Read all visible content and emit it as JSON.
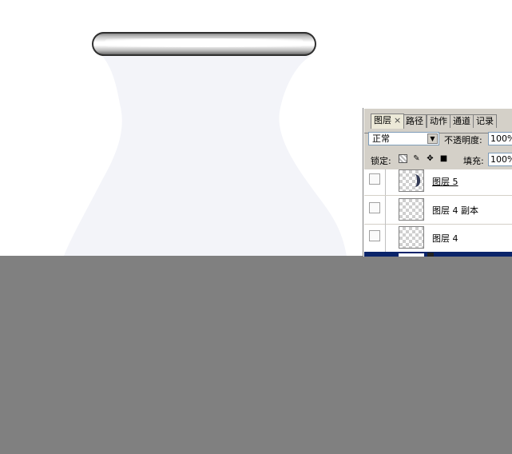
{
  "canvas": {
    "background": "#ffffff",
    "vase_color": "#f3f4f9",
    "rim_color": "#2f2f2f",
    "lower_fill": "#808080"
  },
  "layers_panel": {
    "tabs": [
      {
        "label": "图层",
        "active": true,
        "close": "×"
      },
      {
        "label": "路径",
        "active": false
      },
      {
        "label": "动作",
        "active": false
      },
      {
        "label": "通道",
        "active": false
      },
      {
        "label": "记录",
        "active": false
      }
    ],
    "blend_mode": "正常",
    "opacity_label": "不透明度:",
    "opacity_value": "100%",
    "lock_label": "锁定:",
    "lock_icons": [
      "lock-transparency-icon",
      "lock-brush-icon",
      "lock-move-icon",
      "lock-all-icon"
    ],
    "fill_label": "填充:",
    "fill_value": "100%",
    "layers": [
      {
        "name": "图层 5",
        "underline": true,
        "thumbnail": "arc-shape-icon"
      },
      {
        "name": "图层 4 副本",
        "underline": false,
        "thumbnail": "transparent"
      },
      {
        "name": "图层 4",
        "underline": false,
        "thumbnail": "transparent"
      }
    ],
    "selection_color": "#0a246a"
  }
}
